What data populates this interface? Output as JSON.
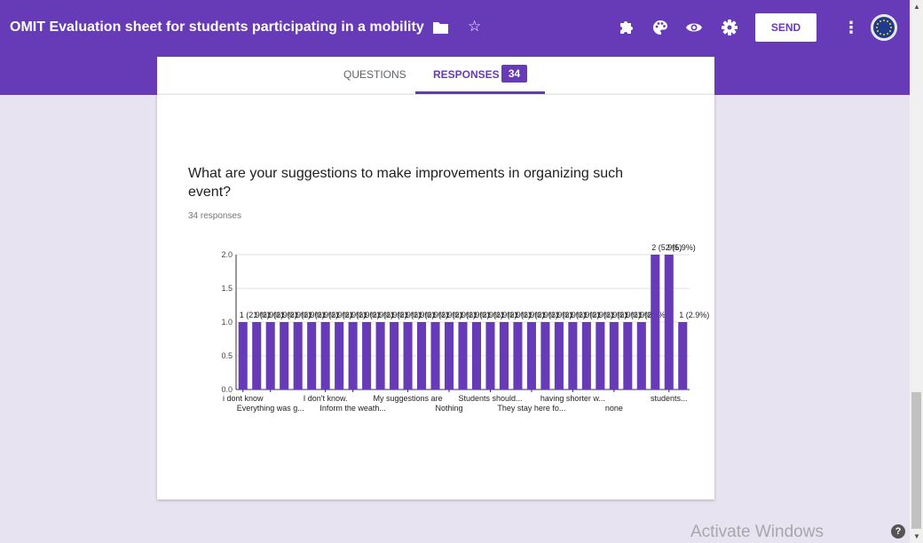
{
  "header": {
    "title": "OMIT Evaluation sheet for students participating in a mobility",
    "send_label": "SEND",
    "star_glyph": "☆",
    "more_glyph": "⋮",
    "icons": [
      "folder-icon",
      "star-icon",
      "addon-puzzle-icon",
      "palette-icon",
      "preview-eye-icon",
      "settings-gear-icon",
      "more-vert-icon",
      "avatar"
    ]
  },
  "tabs": {
    "questions_label": "QUESTIONS",
    "responses_label": "RESPONSES",
    "responses_count": "34"
  },
  "card": {
    "question": "What are your suggestions to make improvements in organizing such event?",
    "responses_text": "34 responses"
  },
  "chart_data": {
    "type": "bar",
    "ylim": [
      0,
      2.0
    ],
    "yticks": [
      "0.0",
      "0.5",
      "1.0",
      "1.5",
      "2.0"
    ],
    "values": [
      1,
      1,
      1,
      1,
      1,
      1,
      1,
      1,
      1,
      1,
      1,
      1,
      1,
      1,
      1,
      1,
      1,
      1,
      1,
      1,
      1,
      1,
      1,
      1,
      1,
      1,
      1,
      1,
      1,
      1,
      2,
      2,
      1
    ],
    "bar_labels": [
      "1 (2.9%)",
      "1 (2.9%)",
      "1 (2.9%)",
      "1 (2.9%)",
      "1 (2.9%)",
      "1 (2.9%)",
      "1 (2.9%)",
      "1 (2.9%)",
      "1 (2.9%)",
      "1 (2.9%)",
      "1 (2.9%)",
      "1 (2.9%)",
      "1 (2.9%)",
      "1 (2.9%)",
      "1 (2.9%)",
      "1 (2.9%)",
      "1 (2.9%)",
      "1 (2.9%)",
      "1 (2.9%)",
      "1 (2.9%)",
      "1 (2.9%)",
      "1 (2.9%)",
      "1 (2.9%)",
      "1 (2.9%)",
      "1 (2.9%)",
      "1 (2.9%)",
      "1 (2.9%)",
      "1 (2.9%)",
      "1 (2.9%)",
      "1 (2.9%)",
      "2 (5.9%)",
      "2 (5.9%)",
      "1 (2.9%)"
    ],
    "category_labels": [
      {
        "index": 0,
        "text": "i dont know",
        "row": 1
      },
      {
        "index": 2,
        "text": "Everything was g...",
        "row": 2
      },
      {
        "index": 6,
        "text": "I don't know.",
        "row": 1
      },
      {
        "index": 8,
        "text": "Inform the weath...",
        "row": 2
      },
      {
        "index": 12,
        "text": "My suggestions are",
        "row": 1
      },
      {
        "index": 15,
        "text": "Nothing",
        "row": 2
      },
      {
        "index": 18,
        "text": "Students should...",
        "row": 1
      },
      {
        "index": 21,
        "text": "They stay here fo...",
        "row": 2
      },
      {
        "index": 24,
        "text": "having shorter w...",
        "row": 1
      },
      {
        "index": 27,
        "text": "none",
        "row": 2
      },
      {
        "index": 31,
        "text": "students...",
        "row": 1
      }
    ],
    "bar_color": "#673ab7"
  },
  "watermark": "Activate Windows",
  "help_glyph": "?"
}
